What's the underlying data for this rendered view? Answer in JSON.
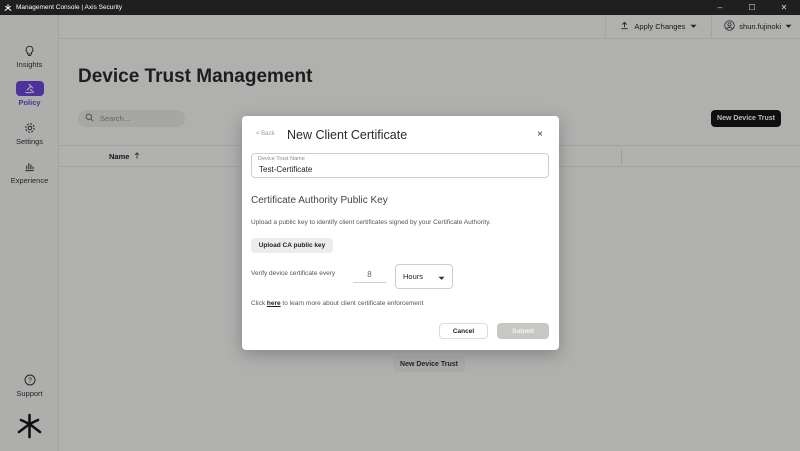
{
  "window": {
    "title": "Management Console | Axis Security",
    "minimize": "–",
    "maximize": "☐",
    "close": "✕"
  },
  "sidebar": {
    "items": [
      {
        "label": "Insights",
        "icon": "lightbulb-icon"
      },
      {
        "label": "Policy",
        "icon": "gavel-icon",
        "active": true
      },
      {
        "label": "Settings",
        "icon": "gear-icon"
      },
      {
        "label": "Experience",
        "icon": "bar-chart-icon"
      }
    ],
    "support_label": "Support",
    "accent": "#6a46d9"
  },
  "header": {
    "apply_label": "Apply Changes",
    "username": "shun.fujinoki"
  },
  "page": {
    "title": "Device Trust Management",
    "search_placeholder": "Search...",
    "new_button": "New Device Trust",
    "column_name": "Name",
    "empty_button": "New Device Trust"
  },
  "modal": {
    "back_label": "< Back",
    "title": "New Client Certificate",
    "close_label": "×",
    "field_label": "Device Trust Name",
    "field_value": "Test-Certificate",
    "section_title": "Certificate Authority Public Key",
    "description": "Upload a public key to identify client certificates signed by your Certificate Authority.",
    "upload_button": "Upload CA public key",
    "verify_label": "Verify device certificate every",
    "verify_value": "8",
    "unit_value": "Hours",
    "learn_prefix": "Click ",
    "learn_link": "here",
    "learn_suffix": " to learn more about client certificate enforcement",
    "cancel_button": "Cancel",
    "submit_button": "Submit"
  }
}
